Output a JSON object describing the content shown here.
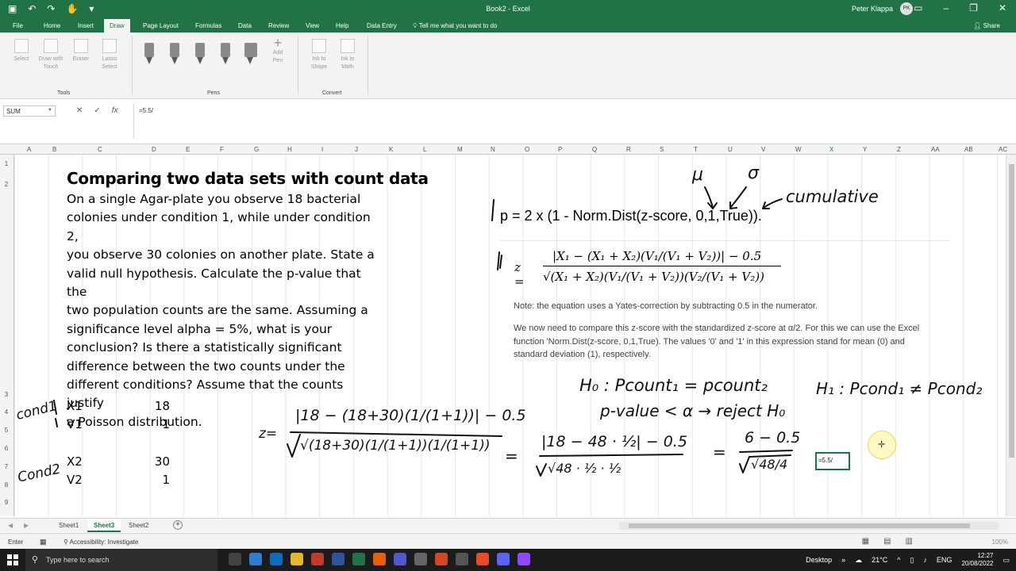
{
  "window": {
    "title": "Book2 - Excel",
    "user": "Peter Klappa",
    "avatar_initials": "PK"
  },
  "ribbon_tabs": [
    "File",
    "Home",
    "Insert",
    "Draw",
    "Page Layout",
    "Formulas",
    "Data",
    "Review",
    "View",
    "Help",
    "Data Entry"
  ],
  "active_tab": "Draw",
  "tell_me": "Tell me what you want to do",
  "share_label": "Share",
  "ribbon": {
    "tools": {
      "label": "Tools",
      "select": "Select",
      "draw_touch": "Draw with Touch",
      "eraser": "Eraser",
      "lasso": "Lasso Select"
    },
    "pens": {
      "label": "Pens",
      "add_pen": "Add Pen"
    },
    "convert": {
      "label": "Convert",
      "ink_shape": "Ink to Shape",
      "ink_math": "Ink to Math"
    }
  },
  "formula_bar": {
    "name_box": "SUM",
    "formula": "=5.5/"
  },
  "columns": [
    "A",
    "B",
    "C",
    "D",
    "E",
    "F",
    "G",
    "H",
    "I",
    "J",
    "K",
    "L",
    "M",
    "N",
    "O",
    "P",
    "Q",
    "R",
    "S",
    "T",
    "U",
    "V",
    "W",
    "X",
    "Y",
    "Z",
    "AA",
    "AB",
    "AC"
  ],
  "rows": [
    "1",
    "2",
    "3",
    "4",
    "5",
    "6",
    "7",
    "8",
    "9"
  ],
  "sheet": {
    "title": "Comparing two data sets with count data",
    "problem": [
      "On a single Agar-plate you observe 18 bacterial",
      "colonies under condition 1, while under condition 2,",
      "you observe 30 colonies on another plate. State a",
      "valid null hypothesis. Calculate the p-value that the",
      "two population counts are the same. Assuming a",
      "significance level  alpha = 5%, what is your",
      "conclusion? Is there a statistically significant",
      "difference between the two counts under the",
      "different conditions? Assume that the counts justify",
      "a Poisson distribution."
    ],
    "data_rows": [
      {
        "label": "X1",
        "value": "18"
      },
      {
        "label": "V1",
        "value": "1"
      },
      {
        "label": "X2",
        "value": "30"
      },
      {
        "label": "V2",
        "value": "1"
      }
    ],
    "p_equation": "p = 2 x (1 - Norm.Dist(z-score, 0,1,True)).",
    "z_equation": {
      "lhs": "z =",
      "numerator": "|X₁ − (X₁ + X₂)(V₁/(V₁ + V₂))| − 0.5",
      "denominator": "√(X₁ + X₂)(V₁/(V₁ + V₂))(V₂/(V₁ + V₂))"
    },
    "note1": "Note: the equation uses a Yates-correction by subtracting 0.5 in the numerator.",
    "note2": "We now need to compare this z-score with the standardized z-score at α/2. For this we can use the Excel function 'Norm.Dist(z-score, 0,1,True). The values '0' and '1' in this expression stand for mean (0) and standard deviation (1), respectively.",
    "active_cell_value": "=5.5/"
  },
  "handwriting": {
    "mu": "μ",
    "sigma": "σ",
    "cumulative": "cumulative",
    "cond1": "cond1",
    "cond2": "Cond2",
    "h0": "H₀ : Pcount₁ = pcount₂",
    "h1": "H₁ : Pcond₁ ≠ Pcond₂",
    "reject": "p-value < α  → reject H₀",
    "z_sub": "z=",
    "num1": "|18 − (18+30)(1/(1+1))| − 0.5",
    "den1": "√(18+30)(1/(1+1))(1/(1+1))",
    "num2": "|18 − 48 · ½| − 0.5",
    "den2": "√48 · ½ · ½",
    "num3": "6 − 0.5",
    "den3": "√48/4",
    "eq": "="
  },
  "sheets": [
    "Sheet1",
    "Sheet3",
    "Sheet2"
  ],
  "active_sheet": "Sheet3",
  "status": {
    "mode": "Enter",
    "accessibility": "Accessibility: Investigate",
    "zoom": "100%"
  },
  "taskbar": {
    "search_placeholder": "Type here to search",
    "desktop": "Desktop",
    "temperature": "21°C",
    "language": "ENG",
    "time": "12:27",
    "date": "20/08/2022"
  },
  "colors": {
    "excel_green": "#217346",
    "ribbon_bg": "#f3f3f3",
    "taskbar": "#1c1c1c"
  }
}
